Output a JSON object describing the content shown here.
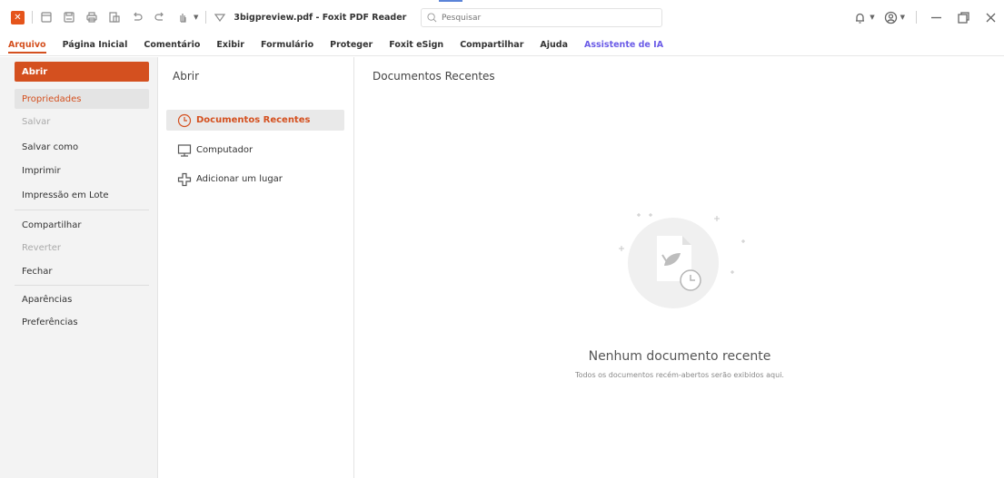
{
  "titlebar": {
    "document_title": "3bigpreview.pdf - Foxit PDF Reader",
    "search_placeholder": "Pesquisar"
  },
  "menu": {
    "items": [
      "Arquivo",
      "Página Inicial",
      "Comentário",
      "Exibir",
      "Formulário",
      "Proteger",
      "Foxit eSign",
      "Compartilhar",
      "Ajuda",
      "Assistente de IA"
    ],
    "active": "Arquivo"
  },
  "left_panel": {
    "items": [
      "Abrir",
      "Propriedades",
      "Salvar",
      "Salvar como",
      "Imprimir",
      "Impressão em Lote",
      "Compartilhar",
      "Reverter",
      "Fechar",
      "Aparências",
      "Preferências"
    ],
    "disabled": [
      "Salvar",
      "Reverter"
    ]
  },
  "middle_panel": {
    "title": "Abrir",
    "items": [
      "Documentos Recentes",
      "Computador",
      "Adicionar um lugar"
    ]
  },
  "content": {
    "title": "Documentos Recentes",
    "empty_title": "Nenhum documento recente",
    "empty_subtitle": "Todos os documentos recém-abertos serão exibidos aqui."
  },
  "colors": {
    "accent": "#d4501f",
    "ai_accent": "#6b5ce7",
    "sidebar_bg": "#f3f3f3"
  }
}
